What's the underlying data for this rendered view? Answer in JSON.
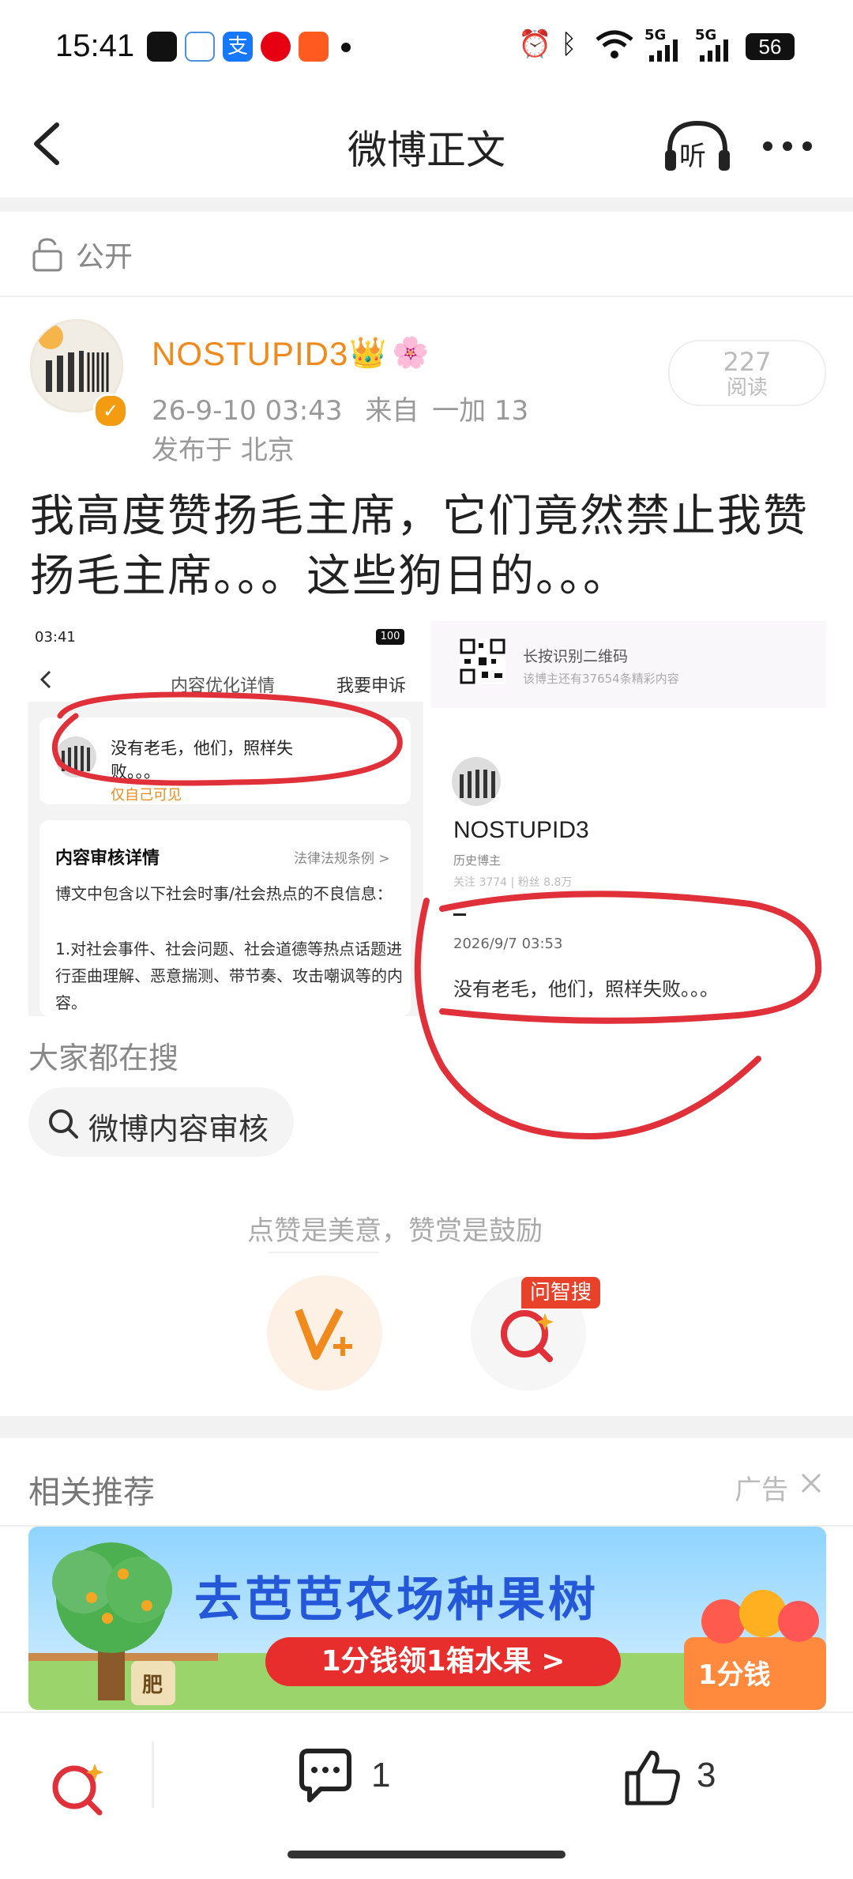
{
  "status_bar": {
    "time": "15:41",
    "battery": "56",
    "net1": "5G",
    "net2": "5G"
  },
  "header": {
    "title": "微博正文",
    "listen_label": "听"
  },
  "visibility": {
    "label": "公开"
  },
  "post": {
    "username": "NOSTUPID3",
    "time": "26-9-10 03:43",
    "source_prefix": "来自",
    "source": "一加 13",
    "location": "发布于 北京",
    "reads_count": "227",
    "reads_label": "阅读",
    "text": "我高度赞扬毛主席，它们竟然禁止我赞扬毛主席。。。这些狗日的。。。",
    "verified_mark": "✓"
  },
  "embedded_left": {
    "time": "03:41",
    "battery": "100",
    "nav_title": "内容优化详情",
    "nav_action": "我要申诉",
    "post_text": "没有老毛，他们，照样失败。。。",
    "visibility_note": "仅自己可见",
    "review_title": "内容审核详情",
    "review_link": "法律法规条例 >",
    "review_body": "博文中包含以下社会时事/社会热点的不良信息：",
    "review_item": "1.对社会事件、社会问题、社会道德等热点话题进行歪曲理解、恶意揣测、带节奏、攻击嘲讽等的内容。"
  },
  "embedded_right": {
    "qr_label": "长按识别二维码",
    "qr_sub": "该博主还有37654条精彩内容",
    "username": "NOSTUPID3",
    "bio": "历史博主",
    "stats": "关注 3774 | 粉丝 8.8万",
    "date": "2026/9/7 03:53",
    "post_text": "没有老毛，他们，照样失败。。。"
  },
  "hot_search": {
    "title": "大家都在搜",
    "chip": "微博内容审核"
  },
  "encourage": {
    "text": "点赞是美意，赞赏是鼓励",
    "ask_badge": "问智搜"
  },
  "recommend": {
    "title": "相关推荐",
    "ad_label": "广告"
  },
  "banner": {
    "headline": "去芭芭农场种果树",
    "cta": "1分钱领1箱水果 >",
    "price_tag": "1分钱",
    "fertilizer": "肥"
  },
  "bottom_bar": {
    "comments": "1",
    "likes": "3"
  },
  "colors": {
    "accent": "#f08a1c",
    "red": "#e0313a",
    "muted": "#999999"
  }
}
